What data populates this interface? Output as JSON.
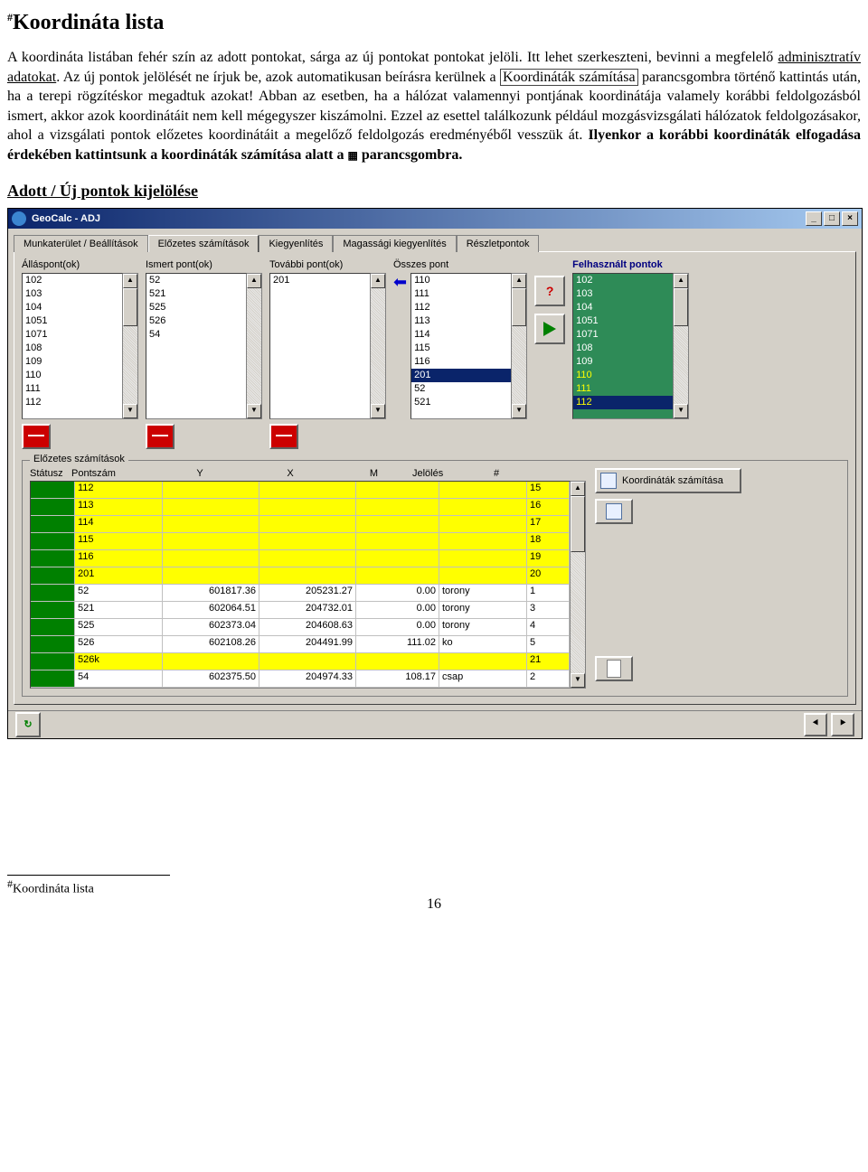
{
  "doc": {
    "title": "Koordináta lista",
    "para1": "A koordináta listában fehér szín az adott pontokat, sárga az új pontokat pontokat jelöli. Itt lehet szerkeszteni, bevinni a megfelelő ",
    "para1_link": "adminisztratív adatokat",
    "para2a": "Az új pontok jelölését ne írjuk be, azok automatikusan beírásra kerülnek a ",
    "para2_box": "Koordináták számítása",
    "para2b": " parancsgombra történő kattintás után, ha a terepi rögzítéskor megadtuk azokat!",
    "para3": " Abban az esetben, ha a hálózat valamennyi pontjának koordinátája valamely korábbi feldolgozásból ismert, akkor azok koordinátáit nem kell mégegyszer kiszámolni. Ezzel az esettel találkozunk például mozgásvizsgálati hálózatok feldolgozásakor, ahol a vizsgálati pontok előzetes koordinátáit a megelőző feldolgozás eredményéből vesszük át. ",
    "para4_bold": "Ilyenkor a korábbi koordináták elfogadása érdekében kattintsunk a koordináták számítása alatt a ",
    "para4_end": " parancsgombra.",
    "h3": "Adott / Új pontok kijelölése",
    "footnote": "Koordináta lista",
    "pagenum": "16"
  },
  "app": {
    "title": "GeoCalc - ADJ",
    "tabs": [
      "Munkaterület / Beállítások",
      "Előzetes számítások",
      "Kiegyenlítés",
      "Magassági kiegyenlítés",
      "Részletpontok"
    ],
    "activeTab": 1,
    "col_labels": {
      "allas": "Álláspont(ok)",
      "ismert": "Ismert pont(ok)",
      "tovabbi": "További pont(ok)",
      "osszes": "Összes pont",
      "felh": "Felhasznált pontok"
    },
    "allaspont": [
      "102",
      "103",
      "104",
      "1051",
      "1071",
      "108",
      "109",
      "110",
      "111",
      "112"
    ],
    "ismert": [
      "52",
      "521",
      "525",
      "526",
      "54"
    ],
    "tovabbi": [
      "201"
    ],
    "osszes": [
      "110",
      "111",
      "112",
      "113",
      "114",
      "115",
      "116",
      "201",
      "52",
      "521"
    ],
    "osszes_selected": 7,
    "felh": [
      "102",
      "103",
      "104",
      "1051",
      "1071",
      "108",
      "109",
      "110",
      "111",
      "112"
    ],
    "felh_yellow_from": 7,
    "felh_selected": 9,
    "fieldset": "Előzetes számítások",
    "grid": {
      "headers": [
        "Státusz",
        "Pontszám",
        "Y",
        "X",
        "M",
        "Jelölés",
        "#"
      ],
      "rows": [
        {
          "y": true,
          "ps": "112",
          "Y": "",
          "X": "",
          "M": "",
          "J": "",
          "H": "15"
        },
        {
          "y": true,
          "ps": "113",
          "Y": "",
          "X": "",
          "M": "",
          "J": "",
          "H": "16"
        },
        {
          "y": true,
          "ps": "114",
          "Y": "",
          "X": "",
          "M": "",
          "J": "",
          "H": "17"
        },
        {
          "y": true,
          "ps": "115",
          "Y": "",
          "X": "",
          "M": "",
          "J": "",
          "H": "18"
        },
        {
          "y": true,
          "ps": "116",
          "Y": "",
          "X": "",
          "M": "",
          "J": "",
          "H": "19"
        },
        {
          "y": true,
          "ps": "201",
          "Y": "",
          "X": "",
          "M": "",
          "J": "",
          "H": "20"
        },
        {
          "y": false,
          "ps": "52",
          "Y": "601817.36",
          "X": "205231.27",
          "M": "0.00",
          "J": "torony",
          "H": "1"
        },
        {
          "y": false,
          "ps": "521",
          "Y": "602064.51",
          "X": "204732.01",
          "M": "0.00",
          "J": "torony",
          "H": "3"
        },
        {
          "y": false,
          "ps": "525",
          "Y": "602373.04",
          "X": "204608.63",
          "M": "0.00",
          "J": "torony",
          "H": "4"
        },
        {
          "y": false,
          "ps": "526",
          "Y": "602108.26",
          "X": "204491.99",
          "M": "111.02",
          "J": "ko",
          "H": "5"
        },
        {
          "y": true,
          "ps": "526k",
          "Y": "",
          "X": "",
          "M": "",
          "J": "",
          "H": "21"
        },
        {
          "y": false,
          "ps": "54",
          "Y": "602375.50",
          "X": "204974.33",
          "M": "108.17",
          "J": "csap",
          "H": "2"
        }
      ]
    },
    "btn_koord": "Koordináták számítása"
  }
}
